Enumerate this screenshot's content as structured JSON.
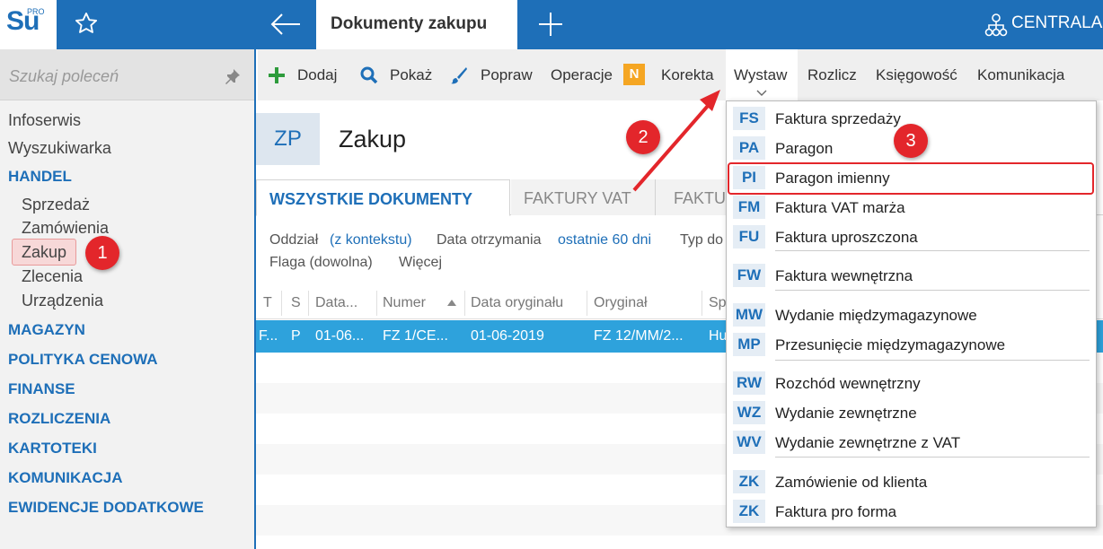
{
  "topbar": {
    "logo_text": "Su",
    "logo_sup": "PRO",
    "active_tab": "Dokumenty zakupu",
    "right_label": "CENTRALA"
  },
  "sidebar": {
    "search_placeholder": "Szukaj poleceń",
    "items": [
      {
        "label": "Infoserwis",
        "kind": "item"
      },
      {
        "label": "Wyszukiwarka",
        "kind": "item"
      },
      {
        "label": "HANDEL",
        "kind": "header"
      },
      {
        "label": "Sprzedaż",
        "kind": "sub"
      },
      {
        "label": "Zamówienia",
        "kind": "sub"
      },
      {
        "label": "Zakup",
        "kind": "sub-selected"
      },
      {
        "label": "Zlecenia",
        "kind": "sub"
      },
      {
        "label": "Urządzenia",
        "kind": "sub"
      },
      {
        "label": "MAGAZYN",
        "kind": "header"
      },
      {
        "label": "POLITYKA CENOWA",
        "kind": "header"
      },
      {
        "label": "FINANSE",
        "kind": "header"
      },
      {
        "label": "ROZLICZENIA",
        "kind": "header"
      },
      {
        "label": "KARTOTEKI",
        "kind": "header"
      },
      {
        "label": "KOMUNIKACJA",
        "kind": "header"
      },
      {
        "label": "EWIDENCJE DODATKOWE",
        "kind": "header"
      }
    ]
  },
  "toolbar": {
    "dodaj": "Dodaj",
    "pokaz": "Pokaż",
    "popraw": "Popraw",
    "operacje": "Operacje",
    "operacje_badge": "N",
    "korekta": "Korekta",
    "wystaw": "Wystaw",
    "rozlicz": "Rozlicz",
    "ksiegowosc": "Księgowość",
    "komunikacja": "Komunikacja"
  },
  "document": {
    "code": "ZP",
    "title": "Zakup"
  },
  "tabs": {
    "all": "WSZYSTKIE DOKUMENTY",
    "vat": "FAKTURY VAT",
    "third": "FAKTU"
  },
  "filters": {
    "oddzial_label": "Oddział",
    "oddzial_value": "(z kontekstu)",
    "data_label": "Data otrzymania",
    "data_value": "ostatnie 60 dni",
    "typ_label": "Typ do",
    "flaga": "Flaga (dowolna)",
    "wiecej": "Więcej"
  },
  "grid": {
    "headers": [
      "T",
      "S",
      "Data...",
      "Numer",
      "Data oryginału",
      "Oryginał",
      "Sp"
    ],
    "row": [
      "F...",
      "P",
      "01-06...",
      "FZ 1/CE...",
      "01-06-2019",
      "FZ 12/MM/2...",
      "Hu"
    ]
  },
  "menu": {
    "items": [
      {
        "code": "FS",
        "label": "Faktura sprzedaży"
      },
      {
        "code": "PA",
        "label": "Paragon"
      },
      {
        "code": "PI",
        "label": "Paragon imienny"
      },
      {
        "code": "FM",
        "label": "Faktura VAT marża"
      },
      {
        "code": "FU",
        "label": "Faktura uproszczona"
      },
      {
        "code": "FW",
        "label": "Faktura wewnętrzna"
      },
      {
        "code": "MW",
        "label": "Wydanie międzymagazynowe"
      },
      {
        "code": "MP",
        "label": "Przesunięcie międzymagazynowe"
      },
      {
        "code": "RW",
        "label": "Rozchód wewnętrzny"
      },
      {
        "code": "WZ",
        "label": "Wydanie zewnętrzne"
      },
      {
        "code": "WV",
        "label": "Wydanie zewnętrzne z VAT"
      },
      {
        "code": "ZK",
        "label": "Zamówienie od klienta"
      },
      {
        "code": "ZK",
        "label": "Faktura pro forma"
      }
    ]
  },
  "annotations": {
    "step1": "1",
    "step2": "2",
    "step3": "3"
  },
  "colors": {
    "brand_blue": "#1e6fb8",
    "row_selected": "#2ea2dc",
    "annotation_red": "#e3262b",
    "badge_orange": "#f5a623"
  }
}
